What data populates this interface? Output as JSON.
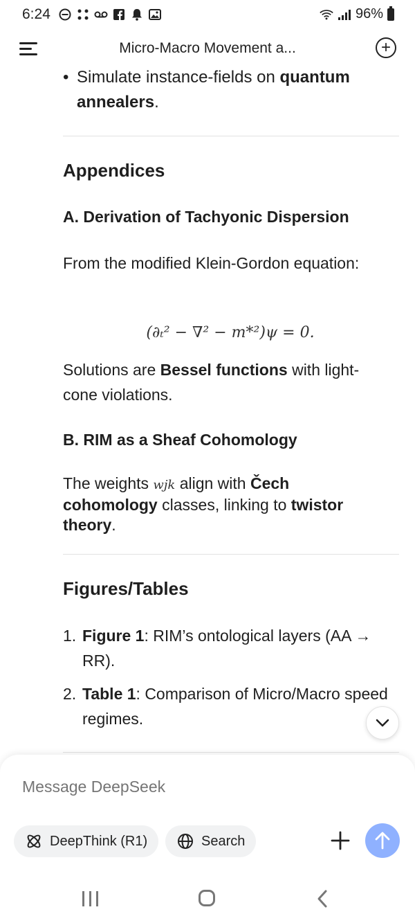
{
  "status_bar": {
    "time": "6:24",
    "battery": "96%"
  },
  "header": {
    "title": "Micro-Macro Movement a..."
  },
  "content": {
    "bullet": {
      "text": "Simulate instance-fields on ",
      "bold": "quantum annealers",
      "end": "."
    },
    "appendices": {
      "heading": "Appendices",
      "a": {
        "heading": "A. Derivation of Tachyonic Dispersion",
        "intro": "From the modified Klein-Gordon equation:",
        "equation": "(∂ₜ² − ∇² − m*²)ψ = 0.",
        "sol_pre": "Solutions are ",
        "sol_bold": "Bessel functions",
        "sol_post": " with light-cone violations."
      },
      "b": {
        "heading": "B. RIM as a Sheaf Cohomology",
        "t1": "The weights ",
        "w": "wjk",
        "t2": " align with ",
        "b1": "Čech cohomology",
        "t3": " classes, linking to ",
        "b2": "twistor theory",
        "t4": "."
      }
    },
    "figures": {
      "heading": "Figures/Tables",
      "items": [
        {
          "num": "1.",
          "bold": "Figure 1",
          "rest": ": RIM’s ontological layers (AA → RR)."
        },
        {
          "num": "2.",
          "bold": "Table 1",
          "rest": ": Comparison of Micro/Macro speed regimes."
        }
      ]
    }
  },
  "composer": {
    "placeholder": "Message DeepSeek",
    "deepthink_label": "DeepThink (R1)",
    "search_label": "Search"
  },
  "colors": {
    "accent": "#8fb1ff",
    "chip_bg": "#f1f2f3",
    "divider": "#e2e2e2"
  }
}
